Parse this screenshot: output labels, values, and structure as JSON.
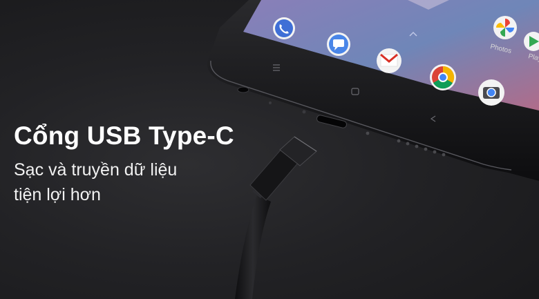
{
  "headline": "Cổng USB Type-C",
  "subline": [
    "Sạc và truyền dữ liệu",
    "tiện lợi hơn"
  ],
  "phone": {
    "app_labels": [
      "Photos",
      "Play Store"
    ],
    "apps": [
      "phone-app-icon",
      "messages-app-icon",
      "gmail-app-icon",
      "chrome-app-icon",
      "camera-app-icon",
      "photos-app-icon",
      "play-store-app-icon"
    ],
    "colors": {
      "body": "#121214",
      "screen": "#6f86b8",
      "accent": "#4a6fd1"
    }
  },
  "colors": {
    "background": "#222225",
    "text": "#ffffff"
  }
}
